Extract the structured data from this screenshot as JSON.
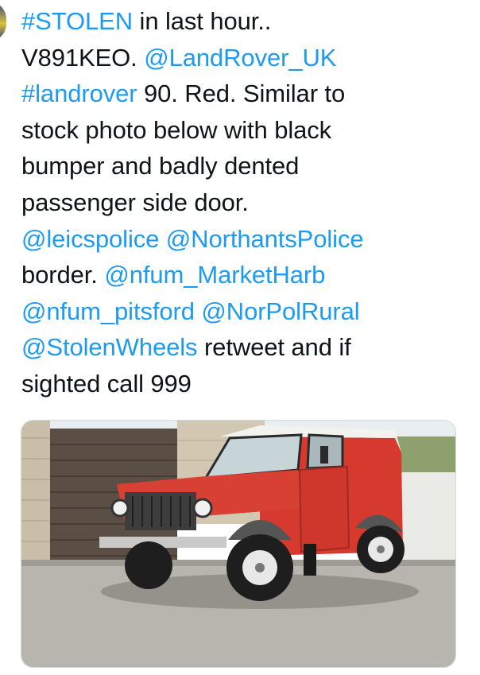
{
  "tweet": {
    "lines": [
      [
        {
          "t": "#STOLEN",
          "link": true
        },
        {
          "t": " in last hour..",
          "link": false
        }
      ],
      [
        {
          "t": "V891KEO. ",
          "link": false
        },
        {
          "t": "@LandRover_UK",
          "link": true
        }
      ],
      [
        {
          "t": "#landrover",
          "link": true
        },
        {
          "t": " 90. Red. Similar to",
          "link": false
        }
      ],
      [
        {
          "t": "stock photo below with black",
          "link": false
        }
      ],
      [
        {
          "t": "bumper and badly dented",
          "link": false
        }
      ],
      [
        {
          "t": "passenger side door.",
          "link": false
        }
      ],
      [
        {
          "t": "@leicspolice",
          "link": true
        },
        {
          "t": " ",
          "link": false
        },
        {
          "t": "@NorthantsPolice",
          "link": true
        }
      ],
      [
        {
          "t": "border. ",
          "link": false
        },
        {
          "t": "@nfum_MarketHarb",
          "link": true
        }
      ],
      [
        {
          "t": "@nfum_pitsford",
          "link": true
        },
        {
          "t": " ",
          "link": false
        },
        {
          "t": "@NorPolRural",
          "link": true
        }
      ],
      [
        {
          "t": "@StolenWheels",
          "link": true
        },
        {
          "t": " retweet and if",
          "link": false
        }
      ],
      [
        {
          "t": "sighted call 999",
          "link": false
        }
      ]
    ]
  },
  "colors": {
    "link": "#1d9bf0",
    "text": "#0f1419",
    "vehicle": "#d63a2f"
  },
  "media": {
    "icon": "photo-land-rover"
  }
}
